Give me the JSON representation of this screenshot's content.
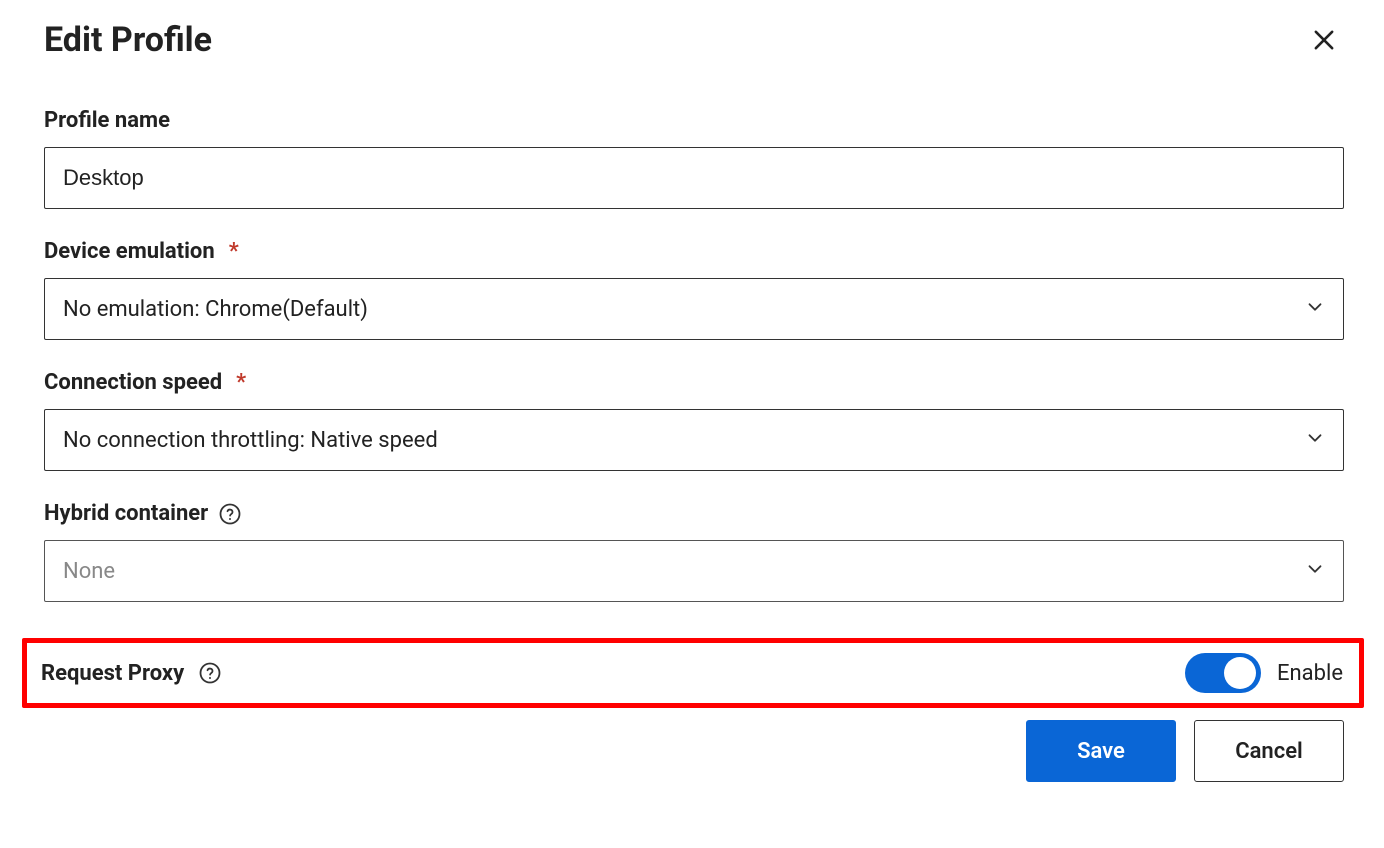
{
  "dialog": {
    "title": "Edit Profile"
  },
  "fields": {
    "profile_name": {
      "label": "Profile name",
      "value": "Desktop"
    },
    "device_emulation": {
      "label": "Device emulation",
      "required_mark": "*",
      "value": "No emulation: Chrome(Default)"
    },
    "connection_speed": {
      "label": "Connection speed",
      "required_mark": "*",
      "value": "No connection throttling: Native speed"
    },
    "hybrid_container": {
      "label": "Hybrid container",
      "value": "None"
    },
    "request_proxy": {
      "label": "Request Proxy",
      "status_label": "Enable",
      "enabled": true
    }
  },
  "actions": {
    "save": "Save",
    "cancel": "Cancel"
  },
  "colors": {
    "primary": "#0a66d6",
    "highlight_border": "#ff0000",
    "required_asterisk": "#c0392b"
  }
}
